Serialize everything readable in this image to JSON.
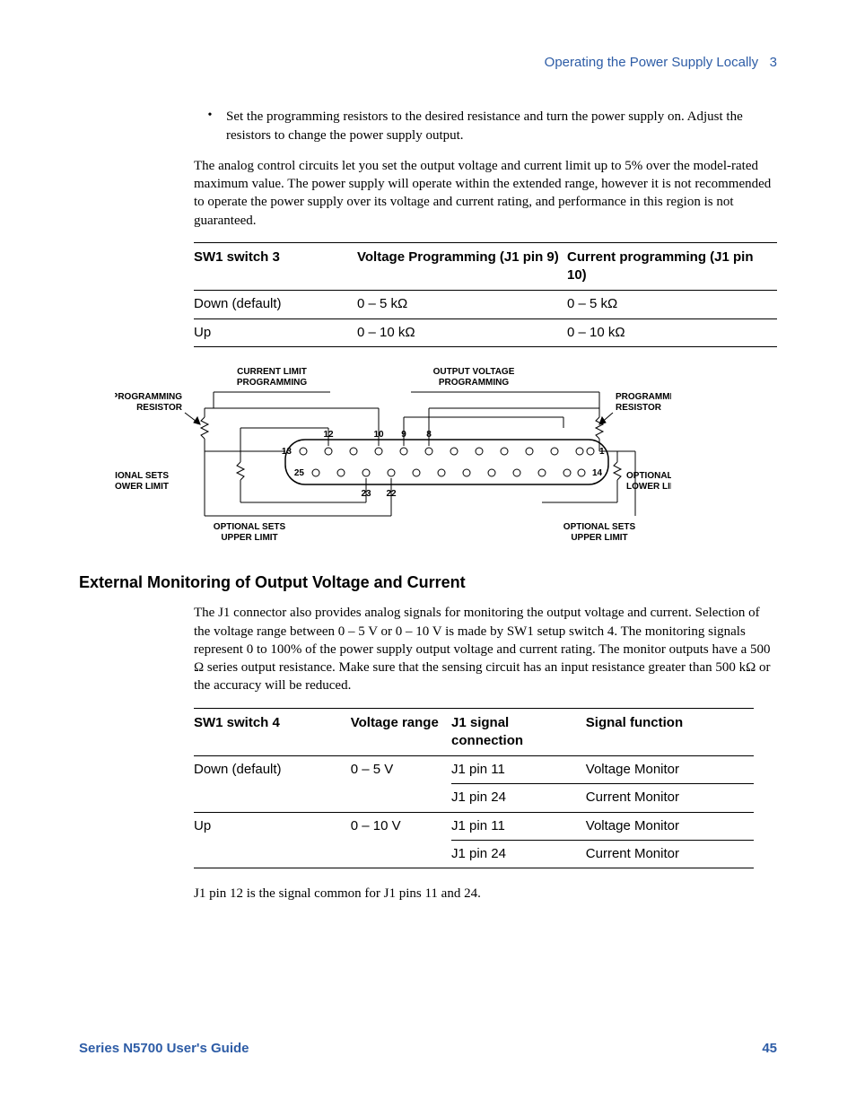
{
  "header": {
    "section": "Operating the Power Supply Locally",
    "chapter": "3"
  },
  "bullet1": "Set the programming resistors to the desired resistance and turn the power supply on. Adjust the resistors to change the power supply output.",
  "para1": "The analog control circuits let you set the output voltage and current limit up to 5% over the model-rated maximum value. The power supply will operate within the extended range, however it is not recommended to operate the power supply over its voltage and current rating, and performance in this region is not guaranteed.",
  "table1": {
    "headers": [
      "SW1 switch 3",
      "Voltage Programming (J1 pin 9)",
      "Current programming (J1 pin 10)"
    ],
    "rows": [
      [
        "Down (default)",
        "0 – 5 kΩ",
        "0 – 5 kΩ"
      ],
      [
        "Up",
        "0 – 10 kΩ",
        "0 – 10 kΩ"
      ]
    ]
  },
  "diagram": {
    "labels": {
      "cl_prog": "CURRENT LIMIT PROGRAMMING",
      "ov_prog": "OUTPUT VOLTAGE PROGRAMMING",
      "prog_res_l": "PROGRAMMING RESISTOR",
      "prog_res_r": "PROGRAMMING RESISTOR",
      "opt_lower_l": "OPTIONAL SETS LOWER LIMIT",
      "opt_lower_r": "OPTIONAL SETS LOWER LIMIT",
      "opt_upper_l": "OPTIONAL SETS UPPER LIMIT",
      "opt_upper_r": "OPTIONAL SETS UPPER LIMIT"
    },
    "pins_top": [
      "13",
      "12",
      "10",
      "9",
      "8",
      "1"
    ],
    "pins_bottom": [
      "25",
      "23",
      "22",
      "14"
    ]
  },
  "h2": "External Monitoring of Output Voltage and Current",
  "para2": "The J1 connector also provides analog signals for monitoring the output voltage and current. Selection of the voltage range between 0 – 5 V or 0 – 10 V is made by SW1 setup switch 4. The monitoring signals represent 0 to 100% of the power supply output voltage and current rating. The monitor outputs have a 500 Ω series output resistance. Make sure that the sensing circuit has an input resistance greater than 500 kΩ or the accuracy will be reduced.",
  "table2": {
    "headers": [
      "SW1 switch 4",
      "Voltage range",
      "J1 signal connection",
      "Signal function"
    ],
    "rows": [
      [
        "Down (default)",
        "0 – 5 V",
        "J1 pin 11",
        "Voltage Monitor"
      ],
      [
        "",
        "",
        "J1 pin 24",
        "Current Monitor"
      ],
      [
        "Up",
        "0 – 10 V",
        "J1 pin 11",
        "Voltage Monitor"
      ],
      [
        "",
        "",
        "J1 pin 24",
        "Current Monitor"
      ]
    ]
  },
  "para3": "J1 pin 12 is the signal common for J1 pins 11 and 24.",
  "footer": {
    "title": "Series N5700 User's Guide",
    "page": "45"
  }
}
